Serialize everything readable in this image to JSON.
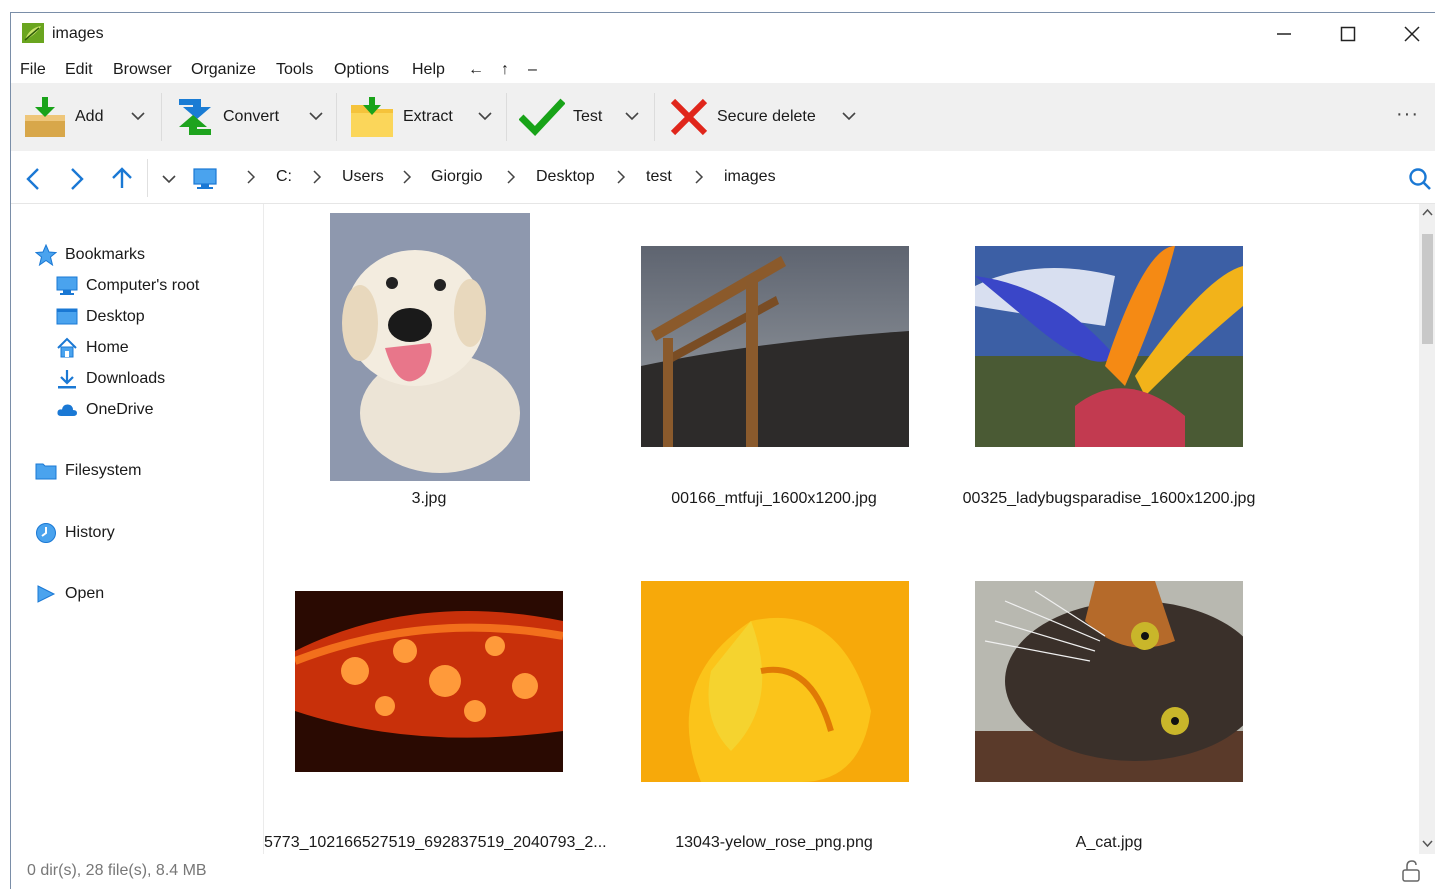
{
  "window": {
    "title": "images",
    "controls": {
      "minimize": "minimize",
      "maximize": "maximize",
      "close": "close"
    }
  },
  "menu": [
    "File",
    "Edit",
    "Browser",
    "Organize",
    "Tools",
    "Options",
    "Help"
  ],
  "menu_extras": [
    "←",
    "↑",
    "–"
  ],
  "toolbar": {
    "add": "Add",
    "convert": "Convert",
    "extract": "Extract",
    "test": "Test",
    "secure_delete": "Secure delete",
    "more": "···"
  },
  "breadcrumb": [
    "C:",
    "Users",
    "Giorgio",
    "Desktop",
    "test",
    "images"
  ],
  "sidebar": {
    "bookmarks": "Bookmarks",
    "items": [
      "Computer's root",
      "Desktop",
      "Home",
      "Downloads",
      "OneDrive"
    ],
    "filesystem": "Filesystem",
    "history": "History",
    "open": "Open"
  },
  "files": [
    {
      "name": "3.jpg",
      "subject": "puppy"
    },
    {
      "name": "00166_mtfuji_1600x1200.jpg",
      "subject": "torii-gate"
    },
    {
      "name": "00325_ladybugsparadise_1600x1200.jpg",
      "subject": "bird-of-paradise-flower"
    },
    {
      "name": "5773_102166527519_692837519_2040793_2...",
      "subject": "water-drops-on-red-leaf"
    },
    {
      "name": "13043-yelow_rose_png.png",
      "subject": "yellow-rose"
    },
    {
      "name": "A_cat.jpg",
      "subject": "cat"
    }
  ],
  "status": "0 dir(s), 28 file(s), 8.4 MB",
  "colors": {
    "accent": "#1a78d4",
    "toolbar_bg": "#f0f0f0",
    "delete_red": "#e0261b",
    "check_green": "#18a318"
  }
}
